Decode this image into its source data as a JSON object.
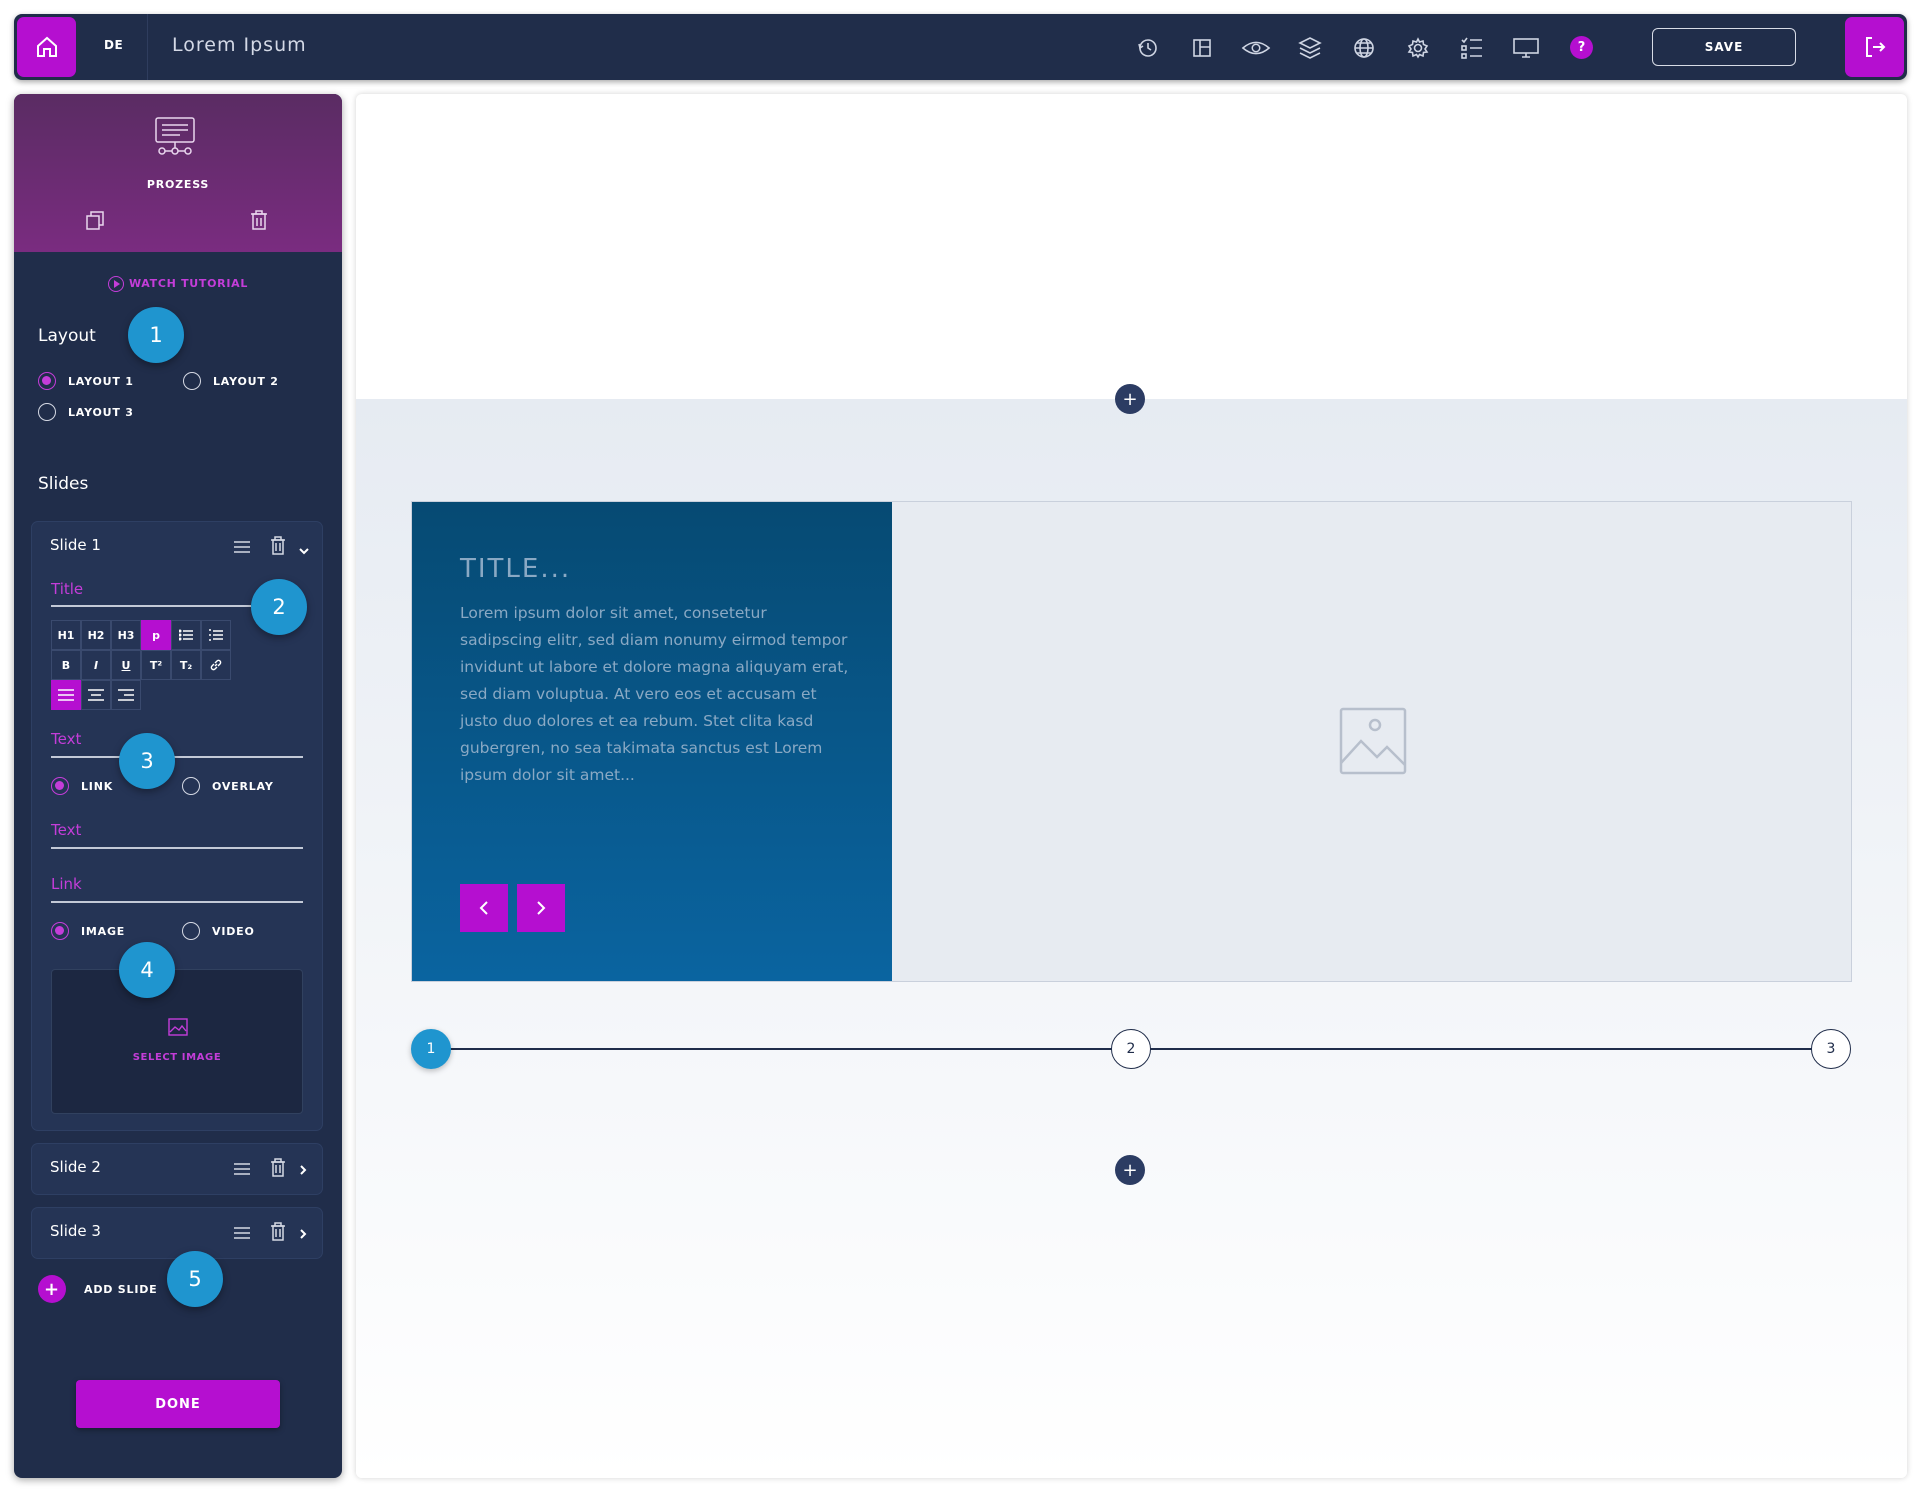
{
  "topbar": {
    "lang": "DE",
    "title": "Lorem Ipsum",
    "help": "?",
    "save_label": "SAVE",
    "icons": [
      "history-icon",
      "layout-icon",
      "eye-icon",
      "layers-icon",
      "globe-icon",
      "settings-icon",
      "checklist-icon",
      "monitor-icon"
    ],
    "accent": "#b50fd0"
  },
  "sidebar": {
    "module_label": "PROZESS",
    "watch_tutorial": "WATCH TUTORIAL",
    "layout_title": "Layout",
    "layouts": [
      {
        "label": "LAYOUT 1",
        "selected": true
      },
      {
        "label": "LAYOUT 2",
        "selected": false
      },
      {
        "label": "LAYOUT 3",
        "selected": false
      }
    ],
    "slides_title": "Slides",
    "slides": [
      {
        "name": "Slide 1",
        "expanded": true
      },
      {
        "name": "Slide 2",
        "expanded": false
      },
      {
        "name": "Slide 3",
        "expanded": false
      }
    ],
    "editor": {
      "title_label": "Title",
      "format_buttons": [
        "H1",
        "H2",
        "H3",
        "p",
        "•≡",
        "1≡",
        "B",
        "I",
        "U",
        "T²",
        "T₂",
        "🔗",
        "⛓"
      ],
      "text_label": "Text",
      "link_options": [
        {
          "label": "LINK",
          "selected": true
        },
        {
          "label": "OVERLAY",
          "selected": false
        }
      ],
      "text2_label": "Text",
      "link_label": "Link",
      "media_options": [
        {
          "label": "IMAGE",
          "selected": true
        },
        {
          "label": "VIDEO",
          "selected": false
        }
      ],
      "select_image": "SELECT IMAGE"
    },
    "add_slide": "ADD SLIDE",
    "done": "DONE"
  },
  "badges": [
    "1",
    "2",
    "3",
    "4",
    "5"
  ],
  "preview": {
    "slide_title": "TITLE...",
    "slide_text": "Lorem ipsum dolor sit amet, consetetur sadipscing elitr, sed diam nonumy eirmod tempor invidunt ut labore et dolore magna aliquyam erat, sed diam voluptua. At vero eos et accusam et justo duo dolores et ea rebum. Stet clita kasd gubergren, no sea takimata sanctus est Lorem ipsum dolor sit amet...",
    "steps": [
      "1",
      "2",
      "3"
    ],
    "active_step": 1,
    "add_symbol": "+"
  }
}
